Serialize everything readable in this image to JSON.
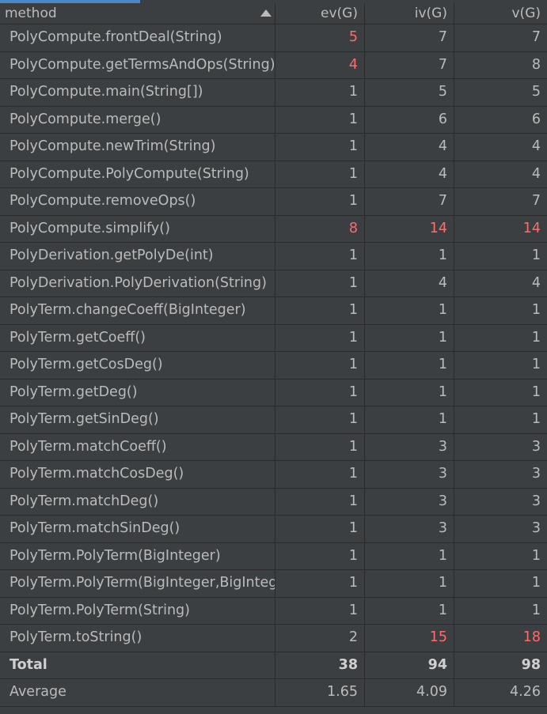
{
  "table": {
    "columns": [
      "method",
      "ev(G)",
      "iv(G)",
      "v(G)"
    ],
    "highlight_color": "#ff6b68",
    "rows": [
      {
        "method": "PolyCompute.frontDeal(String)",
        "ev": "5",
        "iv": "7",
        "v": "7",
        "hl": [
          true,
          false,
          false
        ]
      },
      {
        "method": "PolyCompute.getTermsAndOps(String)",
        "ev": "4",
        "iv": "7",
        "v": "8",
        "hl": [
          true,
          false,
          false
        ]
      },
      {
        "method": "PolyCompute.main(String[])",
        "ev": "1",
        "iv": "5",
        "v": "5",
        "hl": [
          false,
          false,
          false
        ]
      },
      {
        "method": "PolyCompute.merge()",
        "ev": "1",
        "iv": "6",
        "v": "6",
        "hl": [
          false,
          false,
          false
        ]
      },
      {
        "method": "PolyCompute.newTrim(String)",
        "ev": "1",
        "iv": "4",
        "v": "4",
        "hl": [
          false,
          false,
          false
        ]
      },
      {
        "method": "PolyCompute.PolyCompute(String)",
        "ev": "1",
        "iv": "4",
        "v": "4",
        "hl": [
          false,
          false,
          false
        ]
      },
      {
        "method": "PolyCompute.removeOps()",
        "ev": "1",
        "iv": "7",
        "v": "7",
        "hl": [
          false,
          false,
          false
        ]
      },
      {
        "method": "PolyCompute.simplify()",
        "ev": "8",
        "iv": "14",
        "v": "14",
        "hl": [
          true,
          true,
          true
        ]
      },
      {
        "method": "PolyDerivation.getPolyDe(int)",
        "ev": "1",
        "iv": "1",
        "v": "1",
        "hl": [
          false,
          false,
          false
        ]
      },
      {
        "method": "PolyDerivation.PolyDerivation(String)",
        "ev": "1",
        "iv": "4",
        "v": "4",
        "hl": [
          false,
          false,
          false
        ]
      },
      {
        "method": "PolyTerm.changeCoeff(BigInteger)",
        "ev": "1",
        "iv": "1",
        "v": "1",
        "hl": [
          false,
          false,
          false
        ]
      },
      {
        "method": "PolyTerm.getCoeff()",
        "ev": "1",
        "iv": "1",
        "v": "1",
        "hl": [
          false,
          false,
          false
        ]
      },
      {
        "method": "PolyTerm.getCosDeg()",
        "ev": "1",
        "iv": "1",
        "v": "1",
        "hl": [
          false,
          false,
          false
        ]
      },
      {
        "method": "PolyTerm.getDeg()",
        "ev": "1",
        "iv": "1",
        "v": "1",
        "hl": [
          false,
          false,
          false
        ]
      },
      {
        "method": "PolyTerm.getSinDeg()",
        "ev": "1",
        "iv": "1",
        "v": "1",
        "hl": [
          false,
          false,
          false
        ]
      },
      {
        "method": "PolyTerm.matchCoeff()",
        "ev": "1",
        "iv": "3",
        "v": "3",
        "hl": [
          false,
          false,
          false
        ]
      },
      {
        "method": "PolyTerm.matchCosDeg()",
        "ev": "1",
        "iv": "3",
        "v": "3",
        "hl": [
          false,
          false,
          false
        ]
      },
      {
        "method": "PolyTerm.matchDeg()",
        "ev": "1",
        "iv": "3",
        "v": "3",
        "hl": [
          false,
          false,
          false
        ]
      },
      {
        "method": "PolyTerm.matchSinDeg()",
        "ev": "1",
        "iv": "3",
        "v": "3",
        "hl": [
          false,
          false,
          false
        ]
      },
      {
        "method": "PolyTerm.PolyTerm(BigInteger)",
        "ev": "1",
        "iv": "1",
        "v": "1",
        "hl": [
          false,
          false,
          false
        ]
      },
      {
        "method": "PolyTerm.PolyTerm(BigInteger,BigInteg",
        "ev": "1",
        "iv": "1",
        "v": "1",
        "hl": [
          false,
          false,
          false
        ]
      },
      {
        "method": "PolyTerm.PolyTerm(String)",
        "ev": "1",
        "iv": "1",
        "v": "1",
        "hl": [
          false,
          false,
          false
        ]
      },
      {
        "method": "PolyTerm.toString()",
        "ev": "2",
        "iv": "15",
        "v": "18",
        "hl": [
          false,
          true,
          true
        ]
      }
    ],
    "total": {
      "label": "Total",
      "ev": "38",
      "iv": "94",
      "v": "98"
    },
    "average": {
      "label": "Average",
      "ev": "1.65",
      "iv": "4.09",
      "v": "4.26"
    }
  }
}
